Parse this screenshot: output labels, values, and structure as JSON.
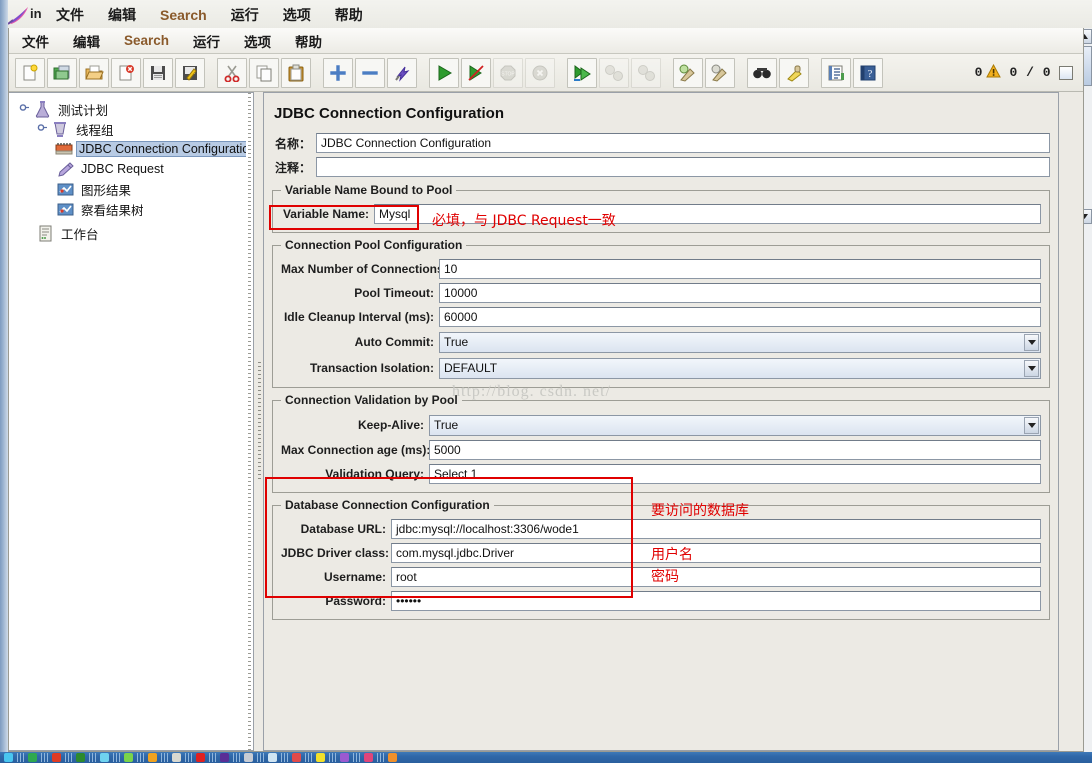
{
  "background_window": {
    "title": "in",
    "icon": "jmeter-feather-icon",
    "menu": [
      {
        "label": "文件",
        "name": "file"
      },
      {
        "label": "编辑",
        "name": "edit"
      },
      {
        "label": "Search",
        "name": "search",
        "accent": true
      },
      {
        "label": "运行",
        "name": "run"
      },
      {
        "label": "选项",
        "name": "options"
      },
      {
        "label": "帮助",
        "name": "help"
      }
    ]
  },
  "menu": [
    {
      "label": "文件",
      "name": "file"
    },
    {
      "label": "编辑",
      "name": "edit"
    },
    {
      "label": "Search",
      "name": "search",
      "accent": true
    },
    {
      "label": "运行",
      "name": "run"
    },
    {
      "label": "选项",
      "name": "options"
    },
    {
      "label": "帮助",
      "name": "help"
    }
  ],
  "toolbar": {
    "buttons": [
      {
        "name": "new-test-plan-icon",
        "enabled": true
      },
      {
        "name": "templates-icon",
        "enabled": true
      },
      {
        "name": "open-icon",
        "enabled": true
      },
      {
        "name": "close-icon",
        "enabled": true
      },
      {
        "name": "save-icon",
        "enabled": true
      },
      {
        "name": "save-as-icon",
        "enabled": true
      },
      {
        "name": "cut-icon",
        "enabled": true
      },
      {
        "name": "copy-icon",
        "enabled": true
      },
      {
        "name": "paste-icon",
        "enabled": true
      },
      {
        "name": "expand-all-icon",
        "enabled": true
      },
      {
        "name": "collapse-all-icon",
        "enabled": true
      },
      {
        "name": "toggle-icon",
        "enabled": true
      },
      {
        "name": "start-icon",
        "enabled": true
      },
      {
        "name": "start-no-timers-icon",
        "enabled": true
      },
      {
        "name": "stop-icon",
        "enabled": false
      },
      {
        "name": "shutdown-icon",
        "enabled": false
      },
      {
        "name": "remote-start-all-icon",
        "enabled": true
      },
      {
        "name": "remote-stop-all-icon",
        "enabled": false
      },
      {
        "name": "remote-shutdown-all-icon",
        "enabled": false
      },
      {
        "name": "clear-icon",
        "enabled": true
      },
      {
        "name": "clear-all-icon",
        "enabled": true
      },
      {
        "name": "search-icon",
        "enabled": true
      },
      {
        "name": "search-reset-icon",
        "enabled": true
      },
      {
        "name": "function-helper-icon",
        "enabled": true
      },
      {
        "name": "help-icon",
        "enabled": true
      }
    ],
    "warning_count": "0",
    "warning_icon": "warning-triangle-icon",
    "run_counter": "0 / 0",
    "active_threads_label": ""
  },
  "tree": {
    "nodes": [
      {
        "label": "测试计划",
        "icon": "test-plan-icon",
        "depth": 0,
        "selected": false,
        "expanded": true
      },
      {
        "label": "线程组",
        "icon": "thread-group-icon",
        "depth": 1,
        "selected": false,
        "expanded": true
      },
      {
        "label": "JDBC Connection Configuration",
        "icon": "jdbc-config-icon",
        "depth": 2,
        "selected": true
      },
      {
        "label": "JDBC Request",
        "icon": "jdbc-request-icon",
        "depth": 2,
        "selected": false
      },
      {
        "label": "图形结果",
        "icon": "graph-results-icon",
        "depth": 2,
        "selected": false
      },
      {
        "label": "察看结果树",
        "icon": "view-results-tree-icon",
        "depth": 2,
        "selected": false
      },
      {
        "label": "工作台",
        "icon": "workbench-icon",
        "depth": 0,
        "selected": false
      }
    ]
  },
  "panel": {
    "title": "JDBC Connection Configuration",
    "name_label": "名称：",
    "name_value": "JDBC Connection Configuration",
    "comment_label": "注释：",
    "comment_value": "",
    "variable_group": {
      "title": "Variable Name Bound to Pool",
      "variable_name_label": "Variable Name:",
      "variable_name_value": "Mysql"
    },
    "pool_group": {
      "title": "Connection Pool Configuration",
      "fields": [
        {
          "label": "Max Number of Connections:",
          "value": "10",
          "type": "text",
          "name": "max-connections-field"
        },
        {
          "label": "Pool Timeout:",
          "value": "10000",
          "type": "text",
          "name": "pool-timeout-field"
        },
        {
          "label": "Idle Cleanup Interval (ms):",
          "value": "60000",
          "type": "text",
          "name": "idle-cleanup-field"
        },
        {
          "label": "Auto Commit:",
          "value": "True",
          "type": "combo",
          "name": "auto-commit-combo"
        },
        {
          "label": "Transaction Isolation:",
          "value": "DEFAULT",
          "type": "combo",
          "name": "transaction-isolation-combo"
        }
      ]
    },
    "validation_group": {
      "title": "Connection Validation by Pool",
      "fields": [
        {
          "label": "Keep-Alive:",
          "value": "True",
          "type": "combo",
          "name": "keep-alive-combo"
        },
        {
          "label": "Max Connection age (ms):",
          "value": "5000",
          "type": "text",
          "name": "max-connection-age-field"
        },
        {
          "label": "Validation Query:",
          "value": "Select 1",
          "type": "text",
          "name": "validation-query-field"
        }
      ]
    },
    "database_group": {
      "title": "Database Connection Configuration",
      "fields": [
        {
          "label": "Database URL:",
          "value": "jdbc:mysql://localhost:3306/wode1",
          "type": "text",
          "name": "database-url-field"
        },
        {
          "label": "JDBC Driver class:",
          "value": "com.mysql.jdbc.Driver",
          "type": "text",
          "name": "jdbc-driver-class-field"
        },
        {
          "label": "Username:",
          "value": "root",
          "type": "text",
          "name": "username-field"
        },
        {
          "label": "Password:",
          "value": "••••••",
          "type": "password",
          "name": "password-field"
        }
      ]
    }
  },
  "annotations": [
    {
      "name": "annotation-variable-name",
      "text": "必填，与 JDBC Request一致"
    },
    {
      "name": "annotation-database-url",
      "text": "要访问的数据库"
    },
    {
      "name": "annotation-username",
      "text": "用户名"
    },
    {
      "name": "annotation-password",
      "text": "密码"
    }
  ],
  "watermark": "http://blog. csdn. net/",
  "colors": {
    "annotation_red": "#e00000",
    "selection_blue": "#b8cbe4",
    "menu_accent": "#8a5a2b",
    "panel_bg": "#eceae4"
  }
}
